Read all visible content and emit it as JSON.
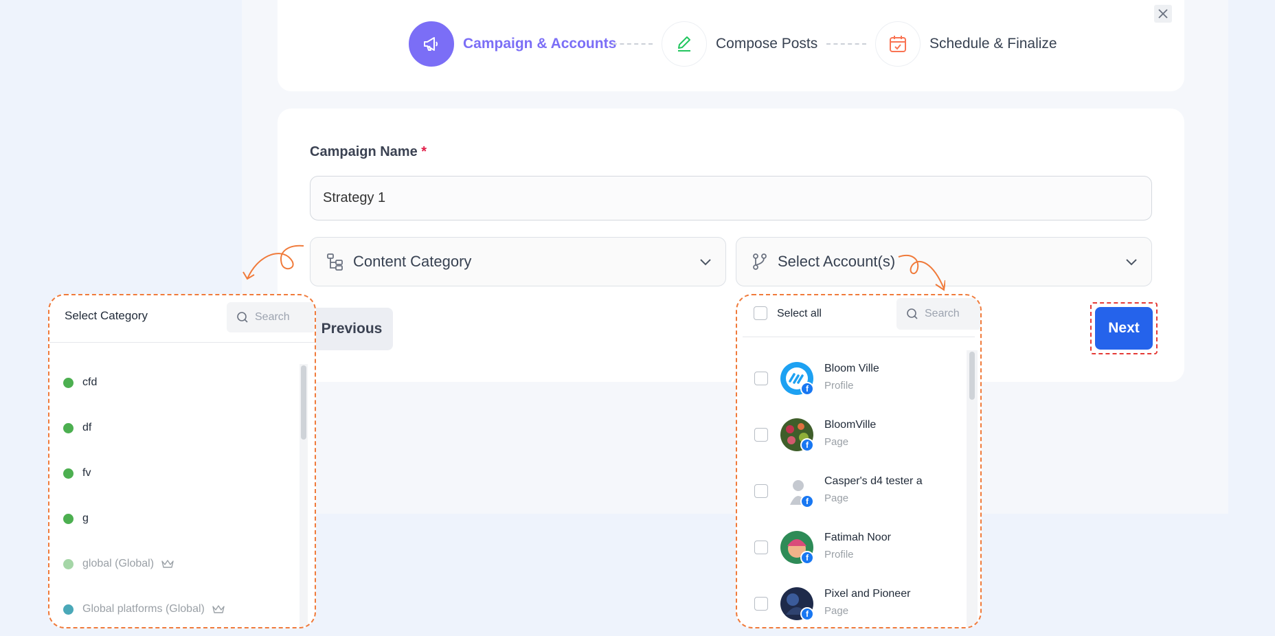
{
  "stepper": {
    "steps": [
      {
        "label": "Campaign & Accounts",
        "icon": "megaphone-icon",
        "active": true
      },
      {
        "label": "Compose Posts",
        "icon": "pencil-icon",
        "active": false
      },
      {
        "label": "Schedule & Finalize",
        "icon": "calendar-check-icon",
        "active": false
      }
    ]
  },
  "form": {
    "campaign_name_label": "Campaign Name",
    "required_mark": "*",
    "campaign_name_value": "Strategy 1",
    "content_category_placeholder": "Content Category",
    "select_accounts_placeholder": "Select Account(s)",
    "previous_label": "Previous",
    "next_label": "Next"
  },
  "category_popover": {
    "title": "Select Category",
    "search_placeholder": "Search",
    "items": [
      {
        "label": "cfd",
        "color": "#4caf50",
        "premium": false
      },
      {
        "label": "df",
        "color": "#4caf50",
        "premium": false
      },
      {
        "label": "fv",
        "color": "#4caf50",
        "premium": false
      },
      {
        "label": "g",
        "color": "#4caf50",
        "premium": false
      },
      {
        "label": "global (Global)",
        "color": "#a5d6a7",
        "premium": true
      },
      {
        "label": "Global platforms (Global)",
        "color": "#4aa8b8",
        "premium": true
      }
    ]
  },
  "accounts_popover": {
    "select_all_label": "Select all",
    "search_placeholder": "Search",
    "items": [
      {
        "name": "Bloom Ville",
        "type": "Profile",
        "platform": "facebook"
      },
      {
        "name": "BloomVille",
        "type": "Page",
        "platform": "facebook"
      },
      {
        "name": "Casper's d4 tester a",
        "type": "Page",
        "platform": "facebook"
      },
      {
        "name": "Fatimah Noor",
        "type": "Profile",
        "platform": "facebook"
      },
      {
        "name": "Pixel and Pioneer",
        "type": "Page",
        "platform": "facebook"
      }
    ]
  },
  "colors": {
    "accent_purple": "#7b6ef6",
    "primary_blue": "#2563eb",
    "annotation_orange": "#f07a3a",
    "annotation_red": "#e53935"
  }
}
